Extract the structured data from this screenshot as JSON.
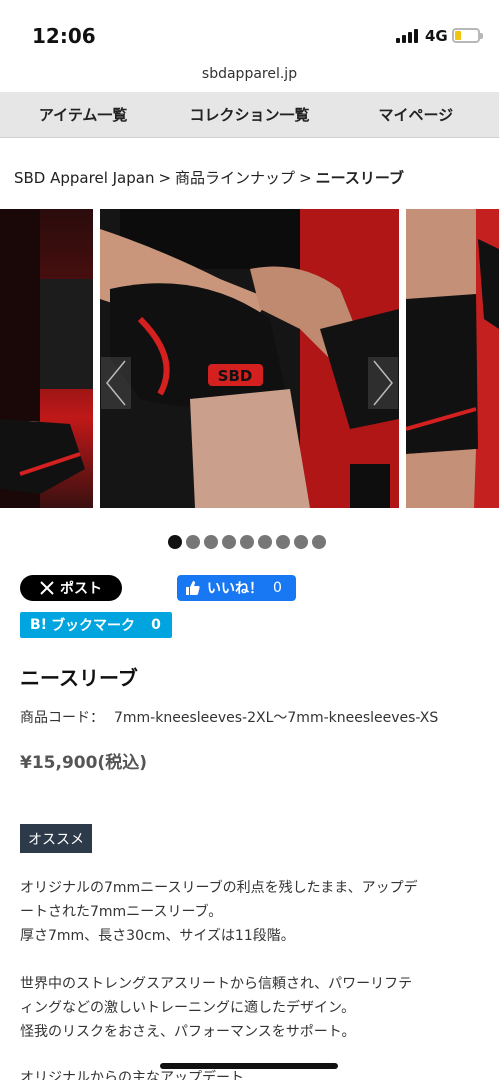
{
  "status": {
    "time": "12:06",
    "network": "4G"
  },
  "browser": {
    "url": "sbdapparel.jp"
  },
  "nav": {
    "items": [
      {
        "label": "アイテム一覧"
      },
      {
        "label": "コレクション一覧"
      },
      {
        "label": "マイページ"
      }
    ]
  },
  "breadcrumb": {
    "items": [
      "SBD Apparel Japan",
      "商品ラインナップ",
      "ニースリーブ"
    ],
    "separator": ">"
  },
  "carousel": {
    "slide_count": 9,
    "active_index": 0,
    "logo_text": "SBD"
  },
  "social": {
    "x_label": "ポスト",
    "like_label": "いいね！",
    "like_count": "0",
    "hatena_icon": "B!",
    "hatena_label": "ブックマーク",
    "hatena_count": "0"
  },
  "product": {
    "title": "ニースリーブ",
    "code_label": "商品コード：",
    "code_value": "7mm-kneesleeves-2XL〜7mm-kneesleeves-XS",
    "price": "¥15,900(税込)",
    "tag": "オススメ",
    "description": [
      [
        "オリジナルの7mmニースリーブの利点を残したまま、アップデ",
        "ートされた7mmニースリーブ。",
        "厚さ7mm、長さ30cm、サイズは11段階。"
      ],
      [
        "世界中のストレングスアスリートから信頼され、パワーリフテ",
        "ィングなどの激しいトレーニングに適したデザイン。",
        "怪我のリスクをおさえ、パフォーマンスをサポート。"
      ],
      [
        "オリジナルからの主なアップデート"
      ]
    ]
  },
  "colors": {
    "nav_bg": "#e6e6e6",
    "x_black": "#000000",
    "facebook_blue": "#1877f2",
    "hatena_blue": "#00a4de",
    "tag_bg": "#2c3a4a",
    "sbd_red": "#c01818"
  }
}
